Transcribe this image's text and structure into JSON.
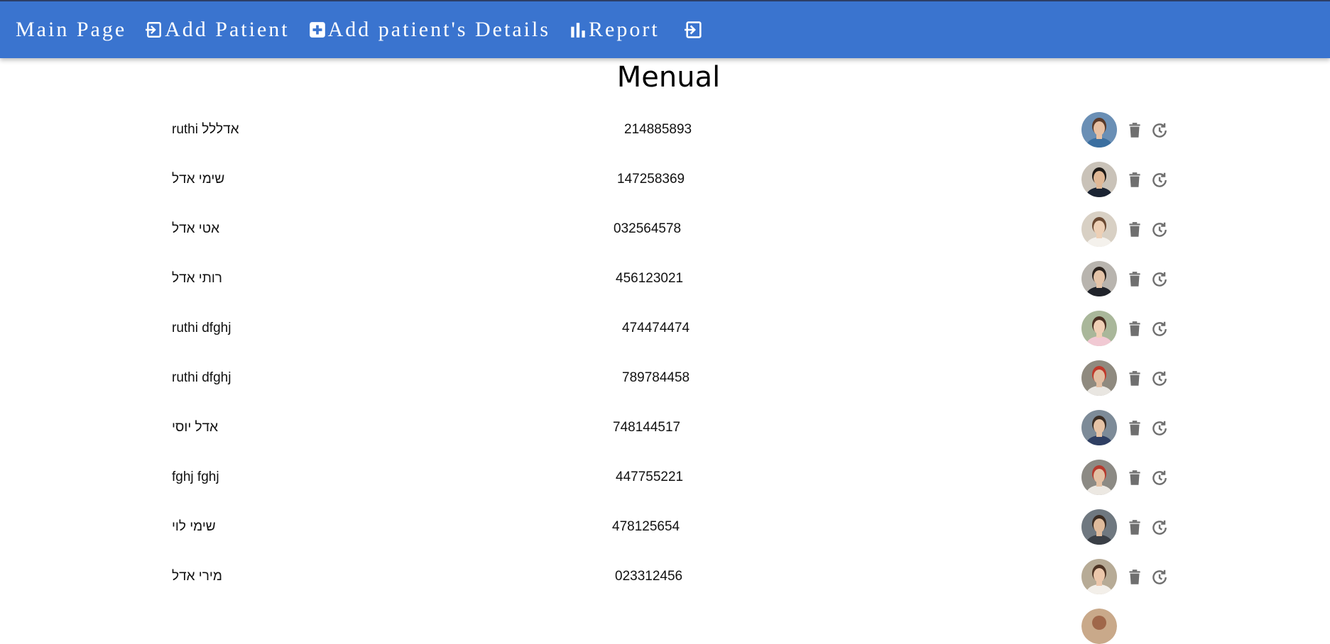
{
  "nav": {
    "main_page": "Main Page",
    "add_patient": "Add Patient",
    "add_details": "Add patient's Details",
    "report": "Report"
  },
  "page_title": "Menual",
  "patients": [
    {
      "name": "ruthi אדללל",
      "id": "214885893",
      "avatar": {
        "bg": "#6a8fb5",
        "skin": "#e7c0a3",
        "hair": "#5a3a2a",
        "shirt": "#3b6fa0"
      }
    },
    {
      "name": "שימי אדל",
      "id": "147258369",
      "avatar": {
        "bg": "#c9c2b8",
        "skin": "#e0b896",
        "hair": "#1e1a17",
        "shirt": "#1b2433"
      }
    },
    {
      "name": "אטי אדל",
      "id": "032564578",
      "avatar": {
        "bg": "#d8d0c4",
        "skin": "#edd0b6",
        "hair": "#6b4a33",
        "shirt": "#f4f1ec"
      }
    },
    {
      "name": "רותי אדל",
      "id": "456123021",
      "avatar": {
        "bg": "#b8b4ae",
        "skin": "#e4c4a8",
        "hair": "#2a221d",
        "shirt": "#20232a"
      }
    },
    {
      "name": "ruthi dfghj",
      "id": "474474474",
      "avatar": {
        "bg": "#a9b79a",
        "skin": "#f0cfb6",
        "hair": "#4a2f22",
        "shirt": "#f1c9d3"
      }
    },
    {
      "name": "ruthi dfghj",
      "id": "789784458",
      "avatar": {
        "bg": "#8f8a7f",
        "skin": "#e2bfa3",
        "hair": "#c0392b",
        "shirt": "#e9e6e1"
      }
    },
    {
      "name": "אדל יוסי",
      "id": "748144517",
      "avatar": {
        "bg": "#7d8b98",
        "skin": "#e6c3a6",
        "hair": "#3a2d24",
        "shirt": "#2f3f63"
      }
    },
    {
      "name": "fghj fghj",
      "id": "447755221",
      "avatar": {
        "bg": "#8c8a84",
        "skin": "#e4c1a4",
        "hair": "#b63a2e",
        "shirt": "#ece8e2"
      }
    },
    {
      "name": "שימי לוי",
      "id": "478125654",
      "avatar": {
        "bg": "#6f7880",
        "skin": "#dfbb9c",
        "hair": "#3b2c22",
        "shirt": "#3a3f46"
      }
    },
    {
      "name": "מירי אדל",
      "id": "023312456",
      "avatar": {
        "bg": "#b7ab96",
        "skin": "#ecc7ab",
        "hair": "#4e3424",
        "shirt": "#f3efe9"
      }
    }
  ],
  "colors": {
    "topbar": "#3a74cf",
    "icon_gray": "#6f6f6f"
  }
}
